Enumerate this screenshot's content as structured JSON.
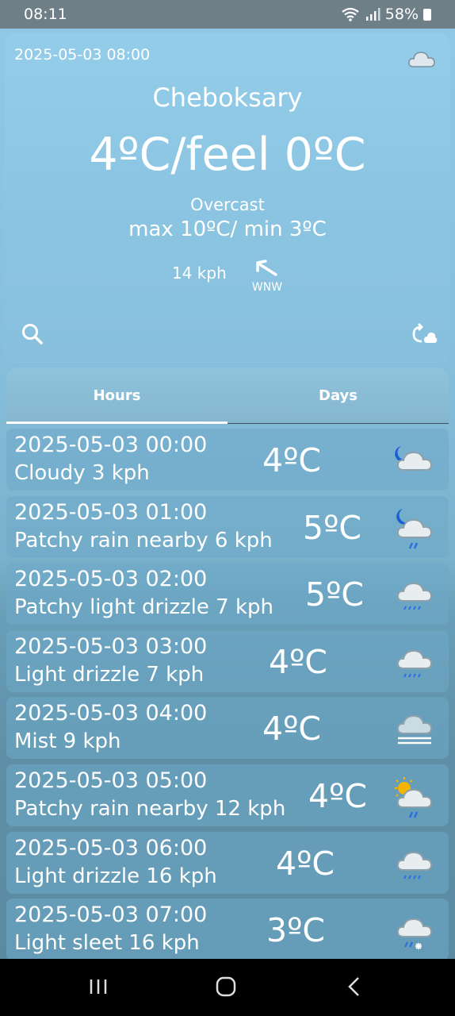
{
  "status": {
    "time": "08:11",
    "battery": "58%"
  },
  "current": {
    "datetime": "2025-05-03 08:00",
    "city": "Cheboksary",
    "temperature": "4ºC/feel 0ºC",
    "condition": "Overcast",
    "max_min": "max 10ºC/ min 3ºC",
    "wind_speed": "14 kph",
    "wind_direction": "WNW",
    "icon": "cloud-icon"
  },
  "tabs": {
    "hours": "Hours",
    "days": "Days",
    "active": "hours"
  },
  "hourly": [
    {
      "date": "2025-05-03 00:00",
      "desc": "Cloudy   3 kph",
      "temp": "4ºC",
      "icon": "cloud-moon-icon"
    },
    {
      "date": "2025-05-03 01:00",
      "desc": "Patchy rain nearby  6 kph",
      "temp": "5ºC",
      "icon": "rain-moon-icon"
    },
    {
      "date": "2025-05-03 02:00",
      "desc": "Patchy light drizzle  7 kph",
      "temp": "5ºC",
      "icon": "drizzle-icon"
    },
    {
      "date": "2025-05-03 03:00",
      "desc": "Light drizzle  7 kph",
      "temp": "4ºC",
      "icon": "drizzle-icon"
    },
    {
      "date": "2025-05-03 04:00",
      "desc": "Mist  9 kph",
      "temp": "4ºC",
      "icon": "mist-icon"
    },
    {
      "date": "2025-05-03 05:00",
      "desc": "Patchy rain nearby  12 kph",
      "temp": "4ºC",
      "icon": "rain-sun-icon"
    },
    {
      "date": "2025-05-03 06:00",
      "desc": "Light drizzle  16 kph",
      "temp": "4ºC",
      "icon": "drizzle-icon"
    },
    {
      "date": "2025-05-03 07:00",
      "desc": "Light sleet  16 kph",
      "temp": "3ºC",
      "icon": "sleet-icon"
    }
  ],
  "colors": {
    "accent": "#ffffff",
    "card": "#8bc5e2",
    "moon": "#1b5fd6",
    "rain": "#2c6fe0",
    "sun": "#f5b400"
  }
}
